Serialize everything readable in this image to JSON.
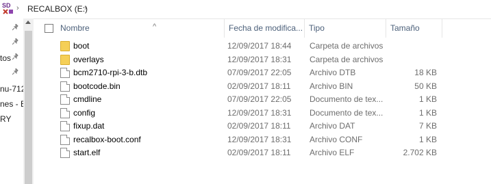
{
  "address": {
    "path": "RECALBOX (E:)",
    "sep1": "›",
    "sep2": "›"
  },
  "nav": {
    "items": [
      {
        "label": ""
      },
      {
        "label": ""
      },
      {
        "label": "tos"
      },
      {
        "label": ""
      },
      {
        "label": "nu-712"
      },
      {
        "label": "nes - B"
      },
      {
        "label": "RY"
      }
    ],
    "pin_glyph": "📌"
  },
  "columns": {
    "name": "Nombre",
    "date": "Fecha de modifica...",
    "type": "Tipo",
    "size": "Tamaño"
  },
  "files": [
    {
      "name": "boot",
      "date": "12/09/2017 18:44",
      "type": "Carpeta de archivos",
      "size": "",
      "icon": "folder-icon"
    },
    {
      "name": "overlays",
      "date": "12/09/2017 18:31",
      "type": "Carpeta de archivos",
      "size": "",
      "icon": "folder-icon"
    },
    {
      "name": "bcm2710-rpi-3-b.dtb",
      "date": "07/09/2017 22:05",
      "type": "Archivo DTB",
      "size": "18 KB",
      "icon": "file-icon"
    },
    {
      "name": "bootcode.bin",
      "date": "02/09/2017 18:11",
      "type": "Archivo BIN",
      "size": "50 KB",
      "icon": "file-icon"
    },
    {
      "name": "cmdline",
      "date": "07/09/2017 22:05",
      "type": "Documento de tex...",
      "size": "1 KB",
      "icon": "file-icon"
    },
    {
      "name": "config",
      "date": "12/09/2017 18:31",
      "type": "Documento de tex...",
      "size": "1 KB",
      "icon": "file-icon"
    },
    {
      "name": "fixup.dat",
      "date": "02/09/2017 18:11",
      "type": "Archivo DAT",
      "size": "7 KB",
      "icon": "file-icon"
    },
    {
      "name": "recalbox-boot.conf",
      "date": "12/09/2017 18:31",
      "type": "Archivo CONF",
      "size": "1 KB",
      "icon": "file-icon"
    },
    {
      "name": "start.elf",
      "date": "02/09/2017 18:11",
      "type": "Archivo ELF",
      "size": "2.702 KB",
      "icon": "file-icon"
    }
  ]
}
